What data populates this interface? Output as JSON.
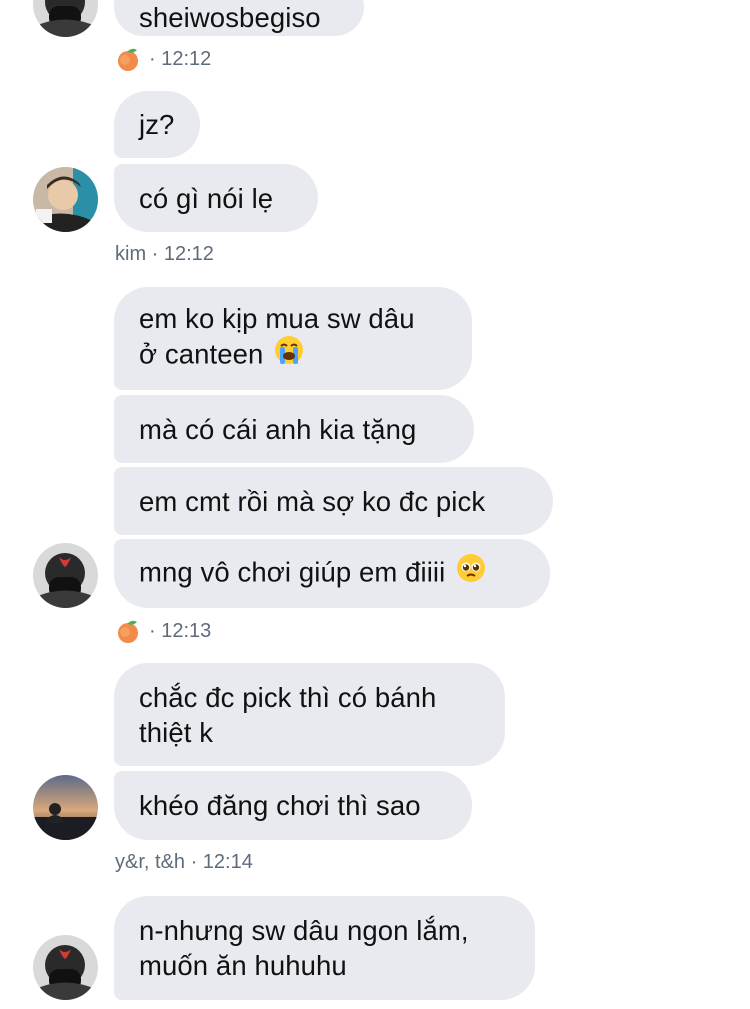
{
  "messages": {
    "m0_line1": "sheiwosbegiso",
    "m0_meta_time": "· 12:12",
    "m1_line1": "jz?",
    "m2_line1": "có gì nói lẹ",
    "m2_meta": "kim · 12:12",
    "m3_line1": "em ko kịp mua sw dâu",
    "m3_line2": "ở canteen",
    "m4_line1": "mà có cái anh kia tặng",
    "m5_line1": "em cmt rồi mà sợ ko đc pick",
    "m6_line1": "mng vô chơi giúp em điiii",
    "m6_meta_time": "· 12:13",
    "m7_line1": "chắc đc pick thì có bánh",
    "m7_line2": "thiệt k",
    "m8_line1": "khéo đăng chơi thì sao",
    "m8_meta": "y&r, t&h · 12:14",
    "m9_line1": "n-nhưng sw dâu ngon lắm,",
    "m9_line2": "muốn ăn huhuhu"
  },
  "icons": {
    "peach": "peach-emoji-icon",
    "crying": "loudly-crying-face-icon",
    "pleading": "pleading-face-icon"
  },
  "colors": {
    "bubble": "#e8eaef",
    "meta_text": "#5f6b7a",
    "text": "#111111"
  }
}
